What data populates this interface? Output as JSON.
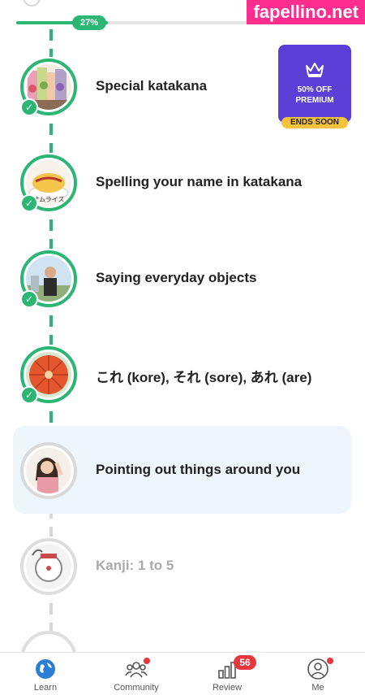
{
  "watermark": "fapellino.net",
  "progress": {
    "label": "27%",
    "value": 0.27,
    "color": "#2bb673"
  },
  "premium": {
    "line1": "50% OFF",
    "line2": "PREMIUM",
    "badge": "ENDS SOON",
    "icon": "crown-icon",
    "color": "#5b3fd6"
  },
  "lessons": [
    {
      "title": "Special katakana",
      "status": "completed"
    },
    {
      "title": "Spelling your name in katakana",
      "status": "completed",
      "thumb_caption": "オムライス"
    },
    {
      "title": "Saying everyday objects",
      "status": "completed"
    },
    {
      "title": "これ (kore), それ (sore), あれ (are)",
      "status": "completed"
    },
    {
      "title": "Pointing out things around you",
      "status": "current"
    },
    {
      "title": "Kanji: 1 to 5",
      "status": "locked"
    }
  ],
  "nav": {
    "items": [
      {
        "label": "Learn",
        "icon": "globe-icon",
        "active": true
      },
      {
        "label": "Community",
        "icon": "people-icon",
        "notification": true
      },
      {
        "label": "Review",
        "icon": "chart-icon",
        "count": "56"
      },
      {
        "label": "Me",
        "icon": "profile-icon",
        "notification": true
      }
    ]
  }
}
